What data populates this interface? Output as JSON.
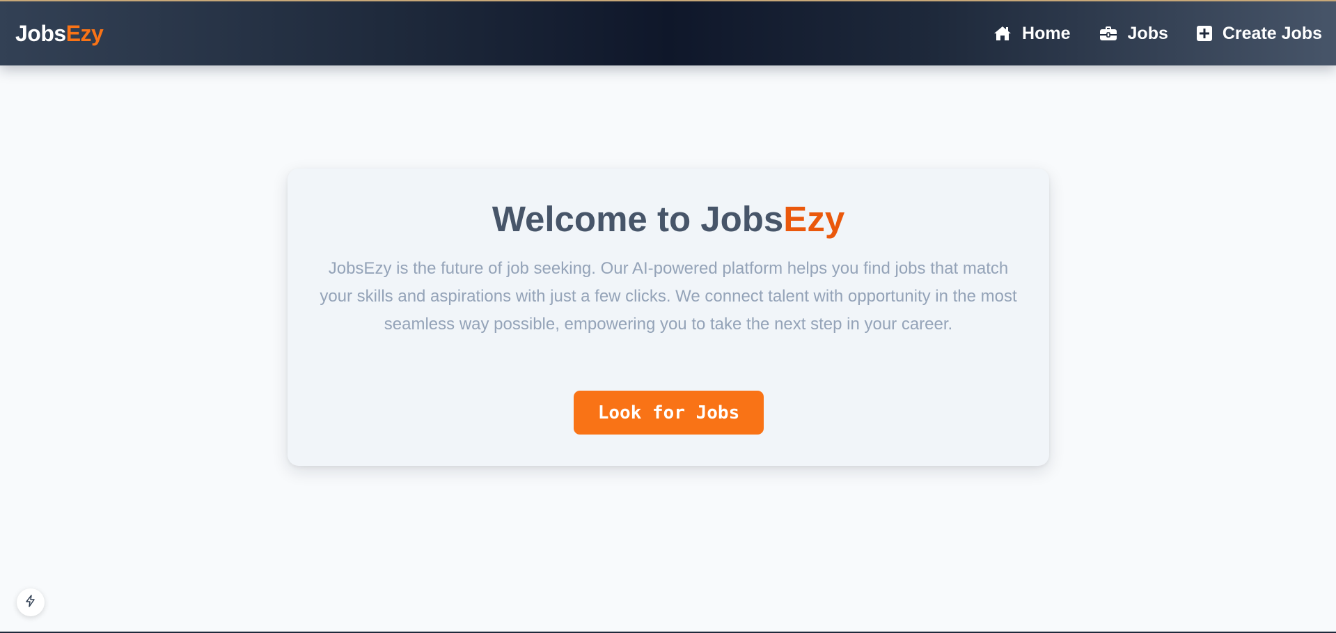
{
  "brand": {
    "name_main": "Jobs",
    "name_accent": "Ezy",
    "accent_color": "#f97316"
  },
  "nav": {
    "items": [
      {
        "label": "Home",
        "icon": "home-icon"
      },
      {
        "label": "Jobs",
        "icon": "briefcase-icon"
      },
      {
        "label": "Create Jobs",
        "icon": "plus-square-icon"
      }
    ]
  },
  "hero": {
    "title_main": "Welcome to Jobs",
    "title_accent": "Ezy",
    "description": "JobsEzy is the future of job seeking. Our AI-powered platform helps you find jobs that match your skills and aspirations with just a few clicks. We connect talent with opportunity in the most seamless way possible, empowering you to take the next step in your career.",
    "cta_label": "Look for Jobs"
  },
  "floating_button": {
    "icon": "lightning-bolt-icon"
  }
}
